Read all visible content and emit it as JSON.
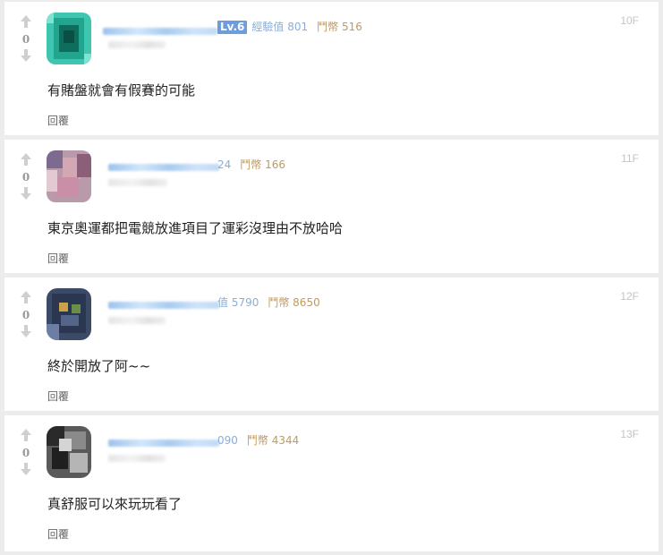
{
  "comments": [
    {
      "votes": "0",
      "level": "Lv.6",
      "exp": "經驗值 801",
      "gp": "鬥幣 516",
      "floor": "10F",
      "text": "有賭盤就會有假賽的可能",
      "reply": "回覆"
    },
    {
      "votes": "0",
      "exp": "24",
      "gp": "鬥幣 166",
      "floor": "11F",
      "text": "東京奧運都把電競放進項目了運彩沒理由不放哈哈",
      "reply": "回覆"
    },
    {
      "votes": "0",
      "exp": "值 5790",
      "gp": "鬥幣 8650",
      "floor": "12F",
      "text": "終於開放了阿~~",
      "reply": "回覆"
    },
    {
      "votes": "0",
      "exp": "090",
      "gp": "鬥幣 4344",
      "floor": "13F",
      "text": "真舒服可以來玩玩看了",
      "reply": "回覆"
    }
  ],
  "colors": {
    "level_badge": "#6d9ddd",
    "exp_text": "#8aaed7",
    "gp_text": "#c09a60",
    "floor_text": "#c4c4c4"
  }
}
